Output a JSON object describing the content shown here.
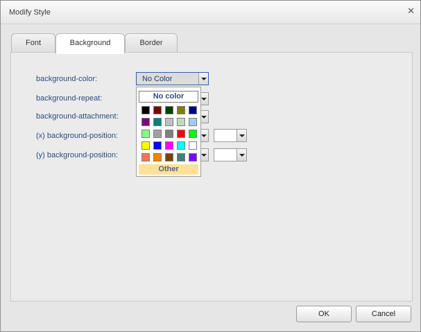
{
  "dialog": {
    "title": "Modify Style"
  },
  "tabs": [
    {
      "label": "Font"
    },
    {
      "label": "Background",
      "active": true
    },
    {
      "label": "Border"
    }
  ],
  "fields": {
    "background_color": {
      "label": "background-color:",
      "value": "No Color"
    },
    "background_repeat": {
      "label": "background-repeat:"
    },
    "background_attachment": {
      "label": "background-attachment:"
    },
    "x_position": {
      "label": "(x) background-position:"
    },
    "y_position": {
      "label": "(y) background-position:"
    }
  },
  "color_picker": {
    "no_color_label": "No color",
    "other_label": "Other",
    "colors": [
      [
        "#000000",
        "#800000",
        "#004000",
        "#808000",
        "#000080"
      ],
      [
        "#800080",
        "#008080",
        "#c0c0c0",
        "#c0dcc0",
        "#a6caf0"
      ],
      [
        "#80ff80",
        "#a0a0a4",
        "#808080",
        "#ff0000",
        "#00ff00"
      ],
      [
        "#ffff00",
        "#0000ff",
        "#ff00ff",
        "#00ffff",
        "#ffffff"
      ],
      [
        "#f07850",
        "#ff8000",
        "#804000",
        "#408080",
        "#8000ff"
      ]
    ]
  },
  "footer": {
    "ok_label": "OK",
    "cancel_label": "Cancel"
  }
}
